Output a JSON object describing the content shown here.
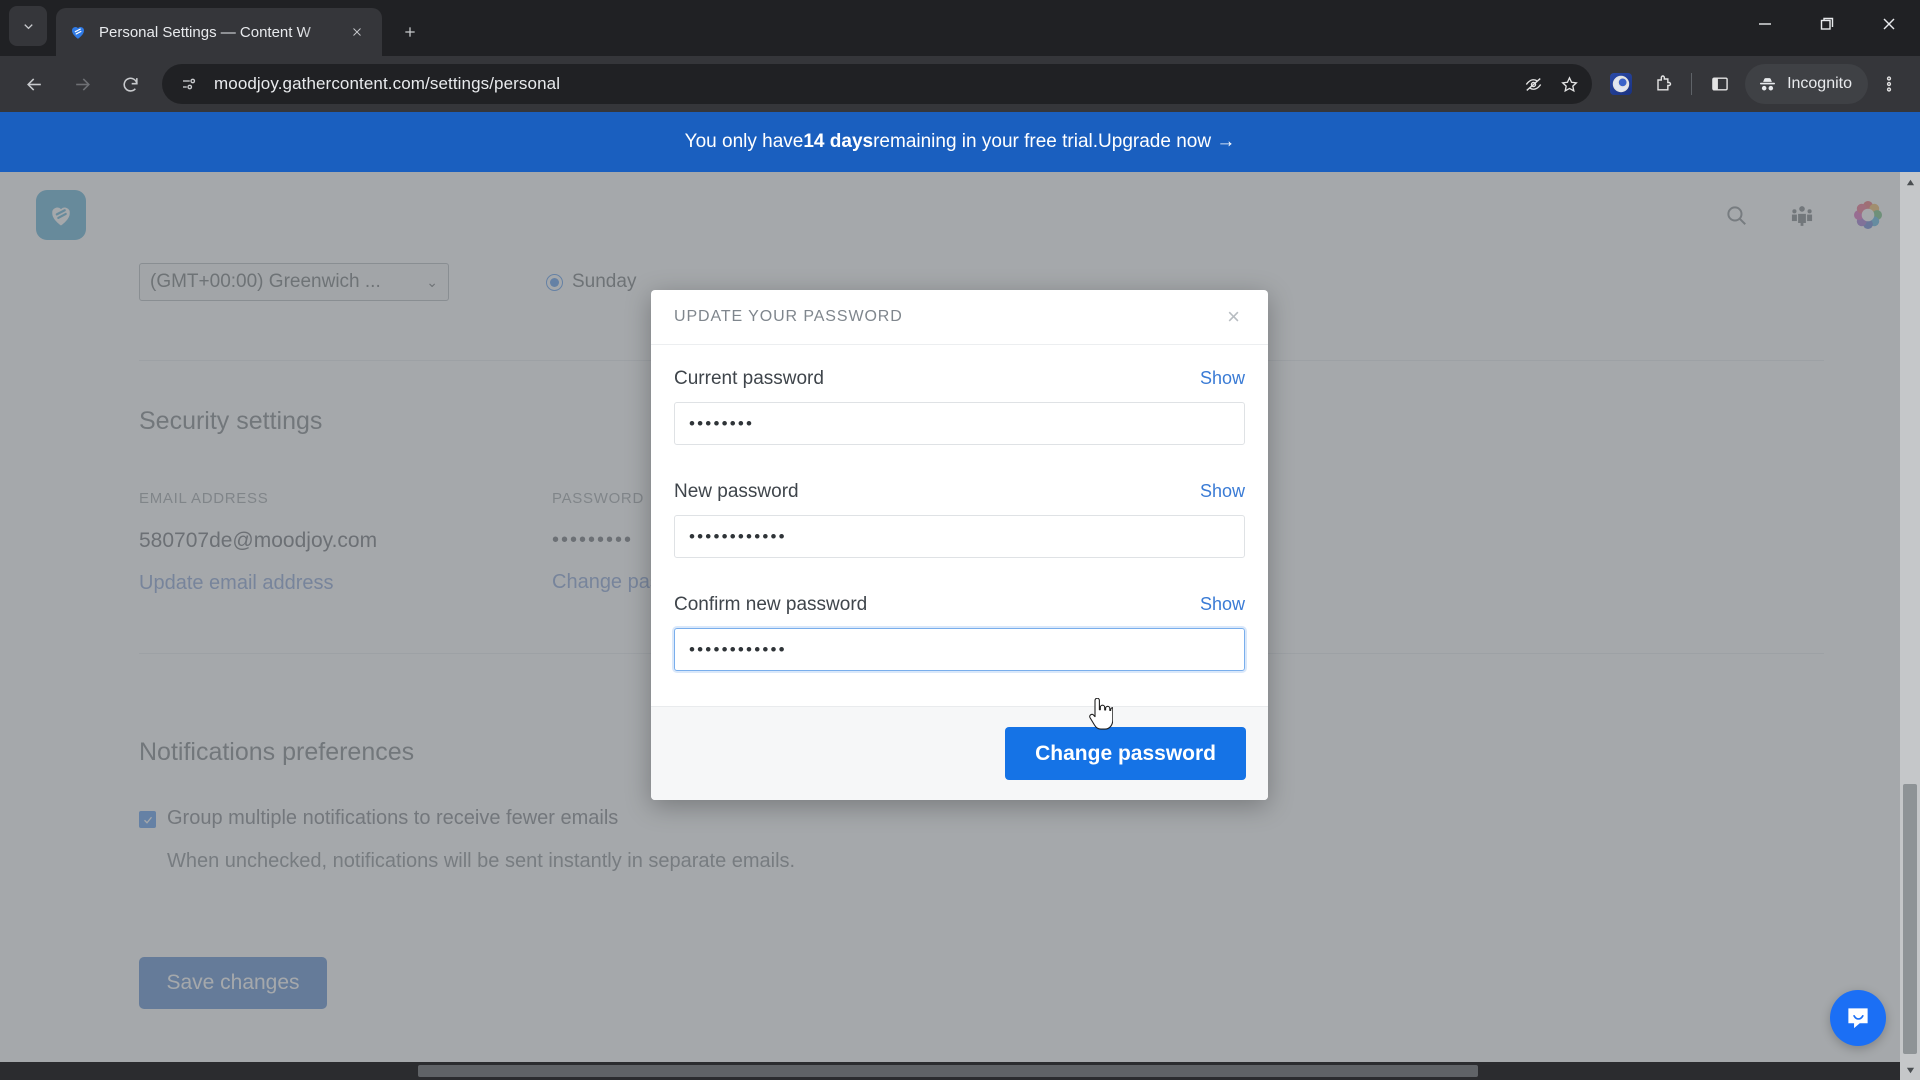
{
  "browser": {
    "tab": {
      "title": "Personal Settings — Content W",
      "favicon": "gathercontent-heart-icon"
    },
    "new_tab_label": "+",
    "omnibox": {
      "url": "moodjoy.gathercontent.com/settings/personal"
    },
    "profile_label": "Incognito",
    "icons": {
      "tab_search": "chevron-down-icon",
      "back": "back-arrow-icon",
      "forward": "forward-arrow-icon",
      "reload": "reload-icon",
      "site_info": "page-settings-icon",
      "hide_password": "eye-off-icon",
      "bookmark": "star-icon",
      "extension_badge": "extension-blue-icon",
      "extensions": "puzzle-piece-icon",
      "side_panel": "side-panel-icon",
      "incognito": "incognito-hat-icon",
      "menu": "kebab-menu-icon",
      "minimize": "minimize-icon",
      "maximize": "maximize-icon",
      "close": "close-icon"
    }
  },
  "banner": {
    "prefix": "You only have ",
    "highlight": "14 days",
    "suffix": " remaining in your free trial. ",
    "cta": "Upgrade now →",
    "bg_color": "#1a5fbf"
  },
  "app_header": {
    "logo_name": "gathercontent-logo",
    "search_icon": "search-icon",
    "team_icon": "team-members-icon",
    "avatar": "rainbow-avatar-icon"
  },
  "settings": {
    "timezone_value": "(GMT+00:00) Greenwich ...",
    "week_start_option": "Sunday",
    "security": {
      "heading": "Security settings",
      "email_label": "EMAIL ADDRESS",
      "email_value": "580707de@moodjoy.com",
      "email_link": "Update email address",
      "password_label": "PASSWORD",
      "password_value": "•••••••••",
      "password_link": "Change password"
    },
    "notifications": {
      "heading": "Notifications preferences",
      "checkbox_label": "Group multiple notifications to receive fewer emails",
      "description": "When unchecked, notifications will be sent instantly in separate emails.",
      "checked": true
    },
    "save_label": "Save changes"
  },
  "modal": {
    "title": "UPDATE YOUR PASSWORD",
    "close_label": "×",
    "fields": [
      {
        "label": "Current password",
        "show_label": "Show",
        "value": "••••••••",
        "focused": false
      },
      {
        "label": "New password",
        "show_label": "Show",
        "value": "••••••••••••",
        "focused": false
      },
      {
        "label": "Confirm new password",
        "show_label": "Show",
        "value": "••••••••••••",
        "focused": true
      }
    ],
    "submit_label": "Change password",
    "accent_color": "#1573e6"
  },
  "intercom": {
    "name": "intercom-chat-launcher"
  }
}
